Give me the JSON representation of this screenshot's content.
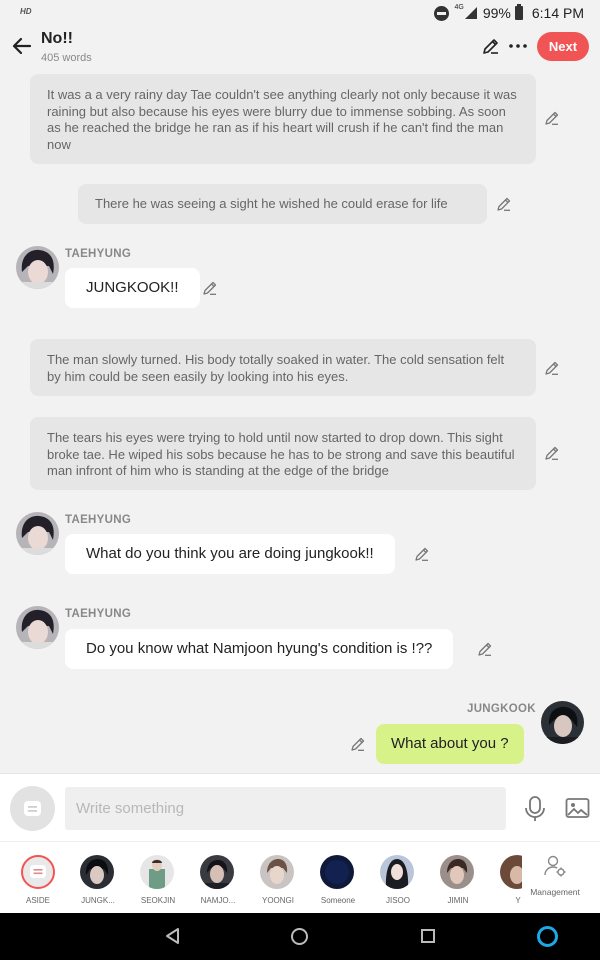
{
  "status_bar": {
    "hd": "HD",
    "network": "4G",
    "battery": "99%",
    "time": "6:14 PM"
  },
  "header": {
    "title": "No!!",
    "word_count": "405 words",
    "next_label": "Next"
  },
  "messages": [
    {
      "type": "narration",
      "text": "It was a a very rainy day Tae couldn't see anything clearly not only because it was raining but also because his eyes were blurry due to immense sobbing. As soon as he reached the bridge he ran as if his heart will crush if he can't find the man now"
    },
    {
      "type": "narration",
      "text": "There he was seeing a sight he wished he could erase for life"
    },
    {
      "type": "character",
      "speaker": "TAEHYUNG",
      "text": "JUNGKOOK!!"
    },
    {
      "type": "narration",
      "text": "The man slowly turned.  His body totally soaked in water. The cold sensation felt by him could be seen easily by looking into his eyes."
    },
    {
      "type": "narration",
      "text": "The tears his eyes were trying to hold until now started to drop down. This sight broke tae. He wiped his sobs because he has to be strong and save this beautiful man infront of him who is standing at the edge of the bridge"
    },
    {
      "type": "character",
      "speaker": "TAEHYUNG",
      "text": "What do you think you are doing jungkook!!"
    },
    {
      "type": "character",
      "speaker": "TAEHYUNG",
      "text": "Do you know what Namjoon hyung's condition is !??"
    },
    {
      "type": "character_self",
      "speaker": "JUNGKOOK",
      "text": "What about you ?"
    }
  ],
  "composer": {
    "placeholder": "Write something"
  },
  "characters": [
    {
      "name": "ASIDE"
    },
    {
      "name": "JUNGK..."
    },
    {
      "name": "SEOKJIN"
    },
    {
      "name": "NAMJO..."
    },
    {
      "name": "YOONGI"
    },
    {
      "name": "Someone"
    },
    {
      "name": "JISOO"
    },
    {
      "name": "JIMIN"
    },
    {
      "name": "Y"
    }
  ],
  "management_label": "Management",
  "colors": {
    "accent": "#f15455",
    "self_bubble": "#d7f288",
    "narration_bg": "#e6e6e6",
    "assistant": "#1da8e8"
  }
}
